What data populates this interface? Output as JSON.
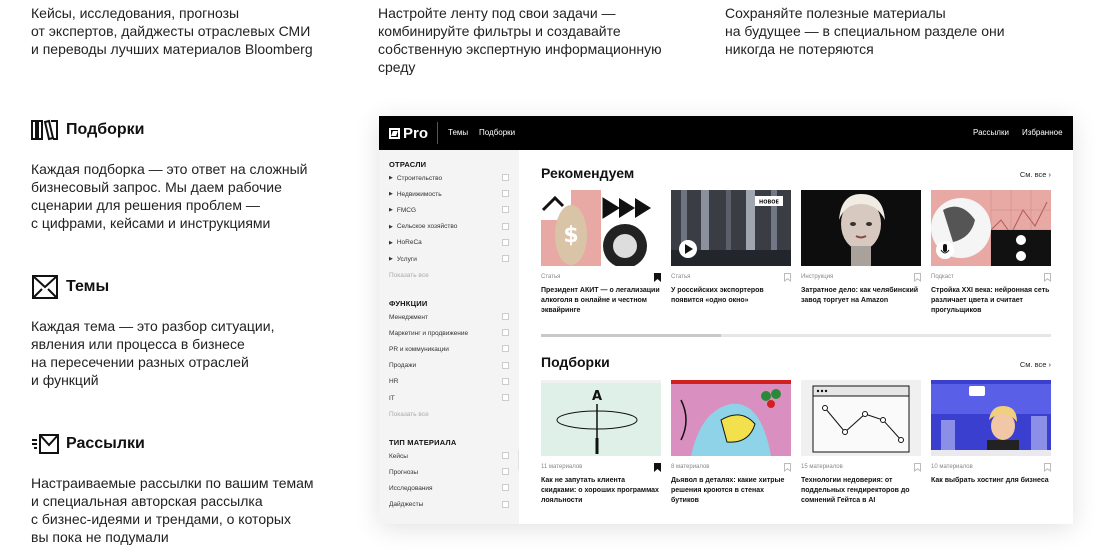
{
  "intro": {
    "col1": [
      "Кейсы, исследования, прогнозы",
      "от экспертов, дайджесты отраслевых СМИ",
      "и переводы лучших материалов Bloomberg"
    ],
    "col2": [
      "Настройте ленту под свои задачи —",
      "комбинируйте фильтры и создавайте",
      "собственную экспертную информационную",
      "среду"
    ],
    "col3": [
      "Сохраняйте полезные материалы",
      "на будущее — в специальном разделе они",
      "никогда не потеряются"
    ]
  },
  "features": [
    {
      "icon": "book-spines-icon",
      "title": "Подборки",
      "desc": [
        "Каждая подборка — это ответ на сложный",
        "бизнесовый запрос. Мы даем рабочие",
        "сценарии для решения проблем —",
        "с цифрами, кейсами и инструкциями"
      ]
    },
    {
      "icon": "envelope-icon",
      "title": "Темы",
      "desc": [
        "Каждая тема — это разбор ситуации,",
        "явления или процесса в бизнесе",
        "на пересечении разных отраслей",
        "и функций"
      ]
    },
    {
      "icon": "fast-mail-icon",
      "title": "Рассылки",
      "desc": [
        "Настраиваемые рассылки по вашим темам",
        "и специальная авторская рассылка",
        "с бизнес-идеями и трендами, о которых",
        "вы пока не подумали"
      ]
    }
  ],
  "app": {
    "logo": "Pro",
    "nav_left": [
      "Темы",
      "Подборки"
    ],
    "nav_right": [
      "Рассылки",
      "Избранное"
    ],
    "sidebar": {
      "groups": [
        {
          "title": "ОТРАСЛИ",
          "items": [
            "Строительство",
            "Недвижимость",
            "FMCG",
            "Сельское хозяйство",
            "HoReCa",
            "Услуги"
          ],
          "arrows": true,
          "more": "Показать все"
        },
        {
          "title": "ФУНКЦИИ",
          "items": [
            "Менеджмент",
            "Маркетинг и продвижение",
            "PR и коммуникации",
            "Продажи",
            "HR",
            "IT"
          ],
          "arrows": false,
          "more": "Показать все"
        },
        {
          "title": "ТИП МАТЕРИАЛА",
          "items": [
            "Кейсы",
            "Прогнозы",
            "Исследования",
            "Дайджесты"
          ],
          "arrows": false,
          "more": ""
        }
      ]
    },
    "recommend": {
      "title": "Рекомендуем",
      "see_all": "См. все",
      "cards": [
        {
          "type": "Статья",
          "title": "Президент АКИТ — о легализации алкоголя в онлайне и честном эквайринге",
          "bookmarked": true
        },
        {
          "type": "Статья",
          "badge": "НОВОЕ",
          "title": "У российских экспортеров появится «одно окно»",
          "bookmarked": false
        },
        {
          "type": "Инструкция",
          "title": "Затратное дело: как челябинский завод торгует на Amazon",
          "bookmarked": false
        },
        {
          "type": "Подкаст",
          "title": "Стройка XXI века: нейронная сеть различает цвета и считает прогульщиков",
          "bookmarked": false
        }
      ]
    },
    "collections": {
      "title": "Подборки",
      "see_all": "См. все",
      "cards": [
        {
          "count": "11 материалов",
          "title": "Как не запутать клиента скидками: о хороших программах лояльности",
          "bookmarked": true
        },
        {
          "count": "8 материалов",
          "title": "Дьявол в деталях: какие хитрые решения кроются в стенах бутиков",
          "bookmarked": false
        },
        {
          "count": "15 материалов",
          "title": "Технологии недоверия: от поддельных гендиректоров до сомнений Гейтса в AI",
          "bookmarked": false
        },
        {
          "count": "10 материалов",
          "title": "Как выбрать хостинг для бизнеса",
          "bookmarked": false
        }
      ]
    }
  },
  "colors": {
    "accent_pink": "#e8a9a4",
    "accent_yellow": "#f3e04d",
    "topbar": "#000000"
  }
}
